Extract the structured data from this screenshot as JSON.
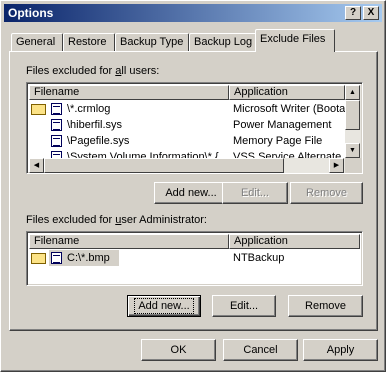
{
  "window": {
    "title": "Options"
  },
  "titlebar": {
    "help_glyph": "?",
    "close_glyph": "X"
  },
  "tabs": [
    {
      "label": "General"
    },
    {
      "label": "Restore"
    },
    {
      "label": "Backup Type"
    },
    {
      "label": "Backup Log"
    },
    {
      "label": "Exclude Files",
      "active": true
    }
  ],
  "all_users": {
    "label_pre": "Files excluded for ",
    "label_ul": "a",
    "label_post": "ll users:",
    "columns": [
      "Filename",
      "Application"
    ],
    "rows": [
      {
        "filename": "\\*.crmlog",
        "application": "Microsoft Writer (Boota..."
      },
      {
        "filename": "\\hiberfil.sys",
        "application": "Power Management"
      },
      {
        "filename": "\\Pagefile.sys",
        "application": "Memory Page File"
      },
      {
        "filename": "\\System Volume Information\\*.{",
        "application": "VSS Service Alternate"
      }
    ],
    "buttons": {
      "add": "Add new...",
      "edit": "Edit...",
      "remove": "Remove"
    }
  },
  "user": {
    "label_pre": "Files excluded for ",
    "label_ul": "u",
    "label_post": "ser Administrator:",
    "columns": [
      "Filename",
      "Application"
    ],
    "rows": [
      {
        "filename": "C:\\*.bmp",
        "application": "NTBackup"
      }
    ],
    "buttons": {
      "add": "Add new...",
      "edit": "Edit...",
      "remove": "Remove"
    }
  },
  "footer": {
    "ok": "OK",
    "cancel": "Cancel",
    "apply": "Apply"
  },
  "colors": {
    "titlebar_start": "#0a246a",
    "titlebar_end": "#a6caf0",
    "face": "#d4d0c8"
  }
}
